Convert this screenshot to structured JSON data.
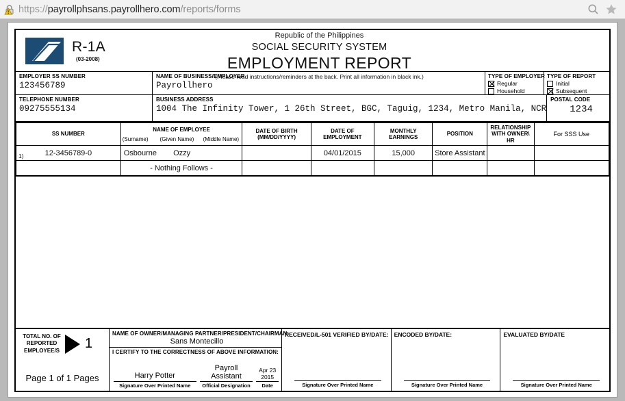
{
  "browser": {
    "url_scheme": "https://",
    "url_host": "payrollphsans.payrollhero.com",
    "url_path": "/reports/forms",
    "security_icon": "insecure-lock-warning-icon",
    "zoom_icon": "zoom-search-icon",
    "bookmark_icon": "star-bookmark-icon"
  },
  "form": {
    "form_code": "R-1A",
    "form_revision": "(03-2008)",
    "logo_name": "sss-logo",
    "title_line1": "Republic of the Philippines",
    "title_line2": "SOCIAL SECURITY SYSTEM",
    "title_line3": "EMPLOYMENT REPORT",
    "title_note": "(Please read instructions/reminders at the back. Print all information in black ink.)",
    "employer": {
      "ss_number_label": "EMPLOYER SS NUMBER",
      "ss_number_value": "123456789",
      "business_name_label": "NAME OF BUSINESS/EMPLOYER",
      "business_name_value": "Payrollhero",
      "telephone_label": "TELEPHONE NUMBER",
      "telephone_value": "09275555134",
      "address_label": "BUSINESS ADDRESS",
      "address_value": "1004 The Infinity Tower, 1 26th Street, BGC, Taguig, 1234, Metro Manila, NCR",
      "postal_label": "POSTAL CODE",
      "postal_value": "1234"
    },
    "type_of_employer": {
      "label": "TYPE OF EMPLOYER",
      "options": [
        {
          "label": "Regular",
          "checked": true
        },
        {
          "label": "Household",
          "checked": false
        }
      ]
    },
    "type_of_report": {
      "label": "TYPE OF REPORT",
      "options": [
        {
          "label": "Initial",
          "checked": false
        },
        {
          "label": "Subsequent",
          "checked": true
        }
      ]
    },
    "table": {
      "headers": {
        "ss_number": "SS NUMBER",
        "name_of_employee": "NAME OF EMPLOYEE",
        "surname": "(Surname)",
        "given_name": "(Given Name)",
        "middle_name": "(Middle Name)",
        "date_of_birth": "DATE OF BIRTH\n(MM/DD/YYYY)",
        "date_of_birth_l1": "DATE OF BIRTH",
        "date_of_birth_l2": "(MM/DD/YYYY)",
        "date_of_employment_l1": "DATE OF",
        "date_of_employment_l2": "EMPLOYMENT",
        "monthly_earnings_l1": "MONTHLY",
        "monthly_earnings_l2": "EARNINGS",
        "position": "POSITION",
        "relationship_l1": "RELATIONSHIP",
        "relationship_l2": "WITH OWNER\\",
        "relationship_l3": "HR",
        "for_sss_use": "For SSS Use"
      },
      "rows": [
        {
          "index": "1)",
          "ss_number": "12-3456789-0",
          "surname": "Osbourne",
          "given_name": "Ozzy",
          "middle_name": "",
          "date_of_birth": "",
          "date_of_employment": "04/01/2015",
          "monthly_earnings": "15,000",
          "position": "Store Assistant",
          "relationship": "",
          "for_sss_use": ""
        }
      ],
      "footer_note": "- Nothing Follows -"
    },
    "footer": {
      "total_label_l1": "TOTAL NO. OF",
      "total_label_l2": "REPORTED",
      "total_label_l3": "EMPLOYEE/S",
      "total_value": "1",
      "page_of": "Page 1 of 1 Pages",
      "owner_label": "NAME OF OWNER/MANAGING PARTNER/PRESIDENT/CHAIRMAN:",
      "owner_value": "Sans Montecillo",
      "certify_label": "I CERTIFY TO THE CORRECTNESS OF ABOVE INFORMATION:",
      "signature_value": "Harry Potter",
      "designation_value": "Payroll Assistant",
      "date_value_l1": "Apr 23",
      "date_value_l2": "2015",
      "cap_signature": "Signature Over Printed Name",
      "cap_designation": "Official Designation",
      "cap_date": "Date",
      "boxes": [
        {
          "label": "RECEIVED/L-501 VERIFIED BY/DATE:",
          "caption": "Signature Over Printed Name"
        },
        {
          "label": "ENCODED BY/DATE:",
          "caption": "Signature Over Printed Name"
        },
        {
          "label": "EVALUATED BY/DATE",
          "caption": "Signature Over Printed Name"
        }
      ]
    }
  }
}
